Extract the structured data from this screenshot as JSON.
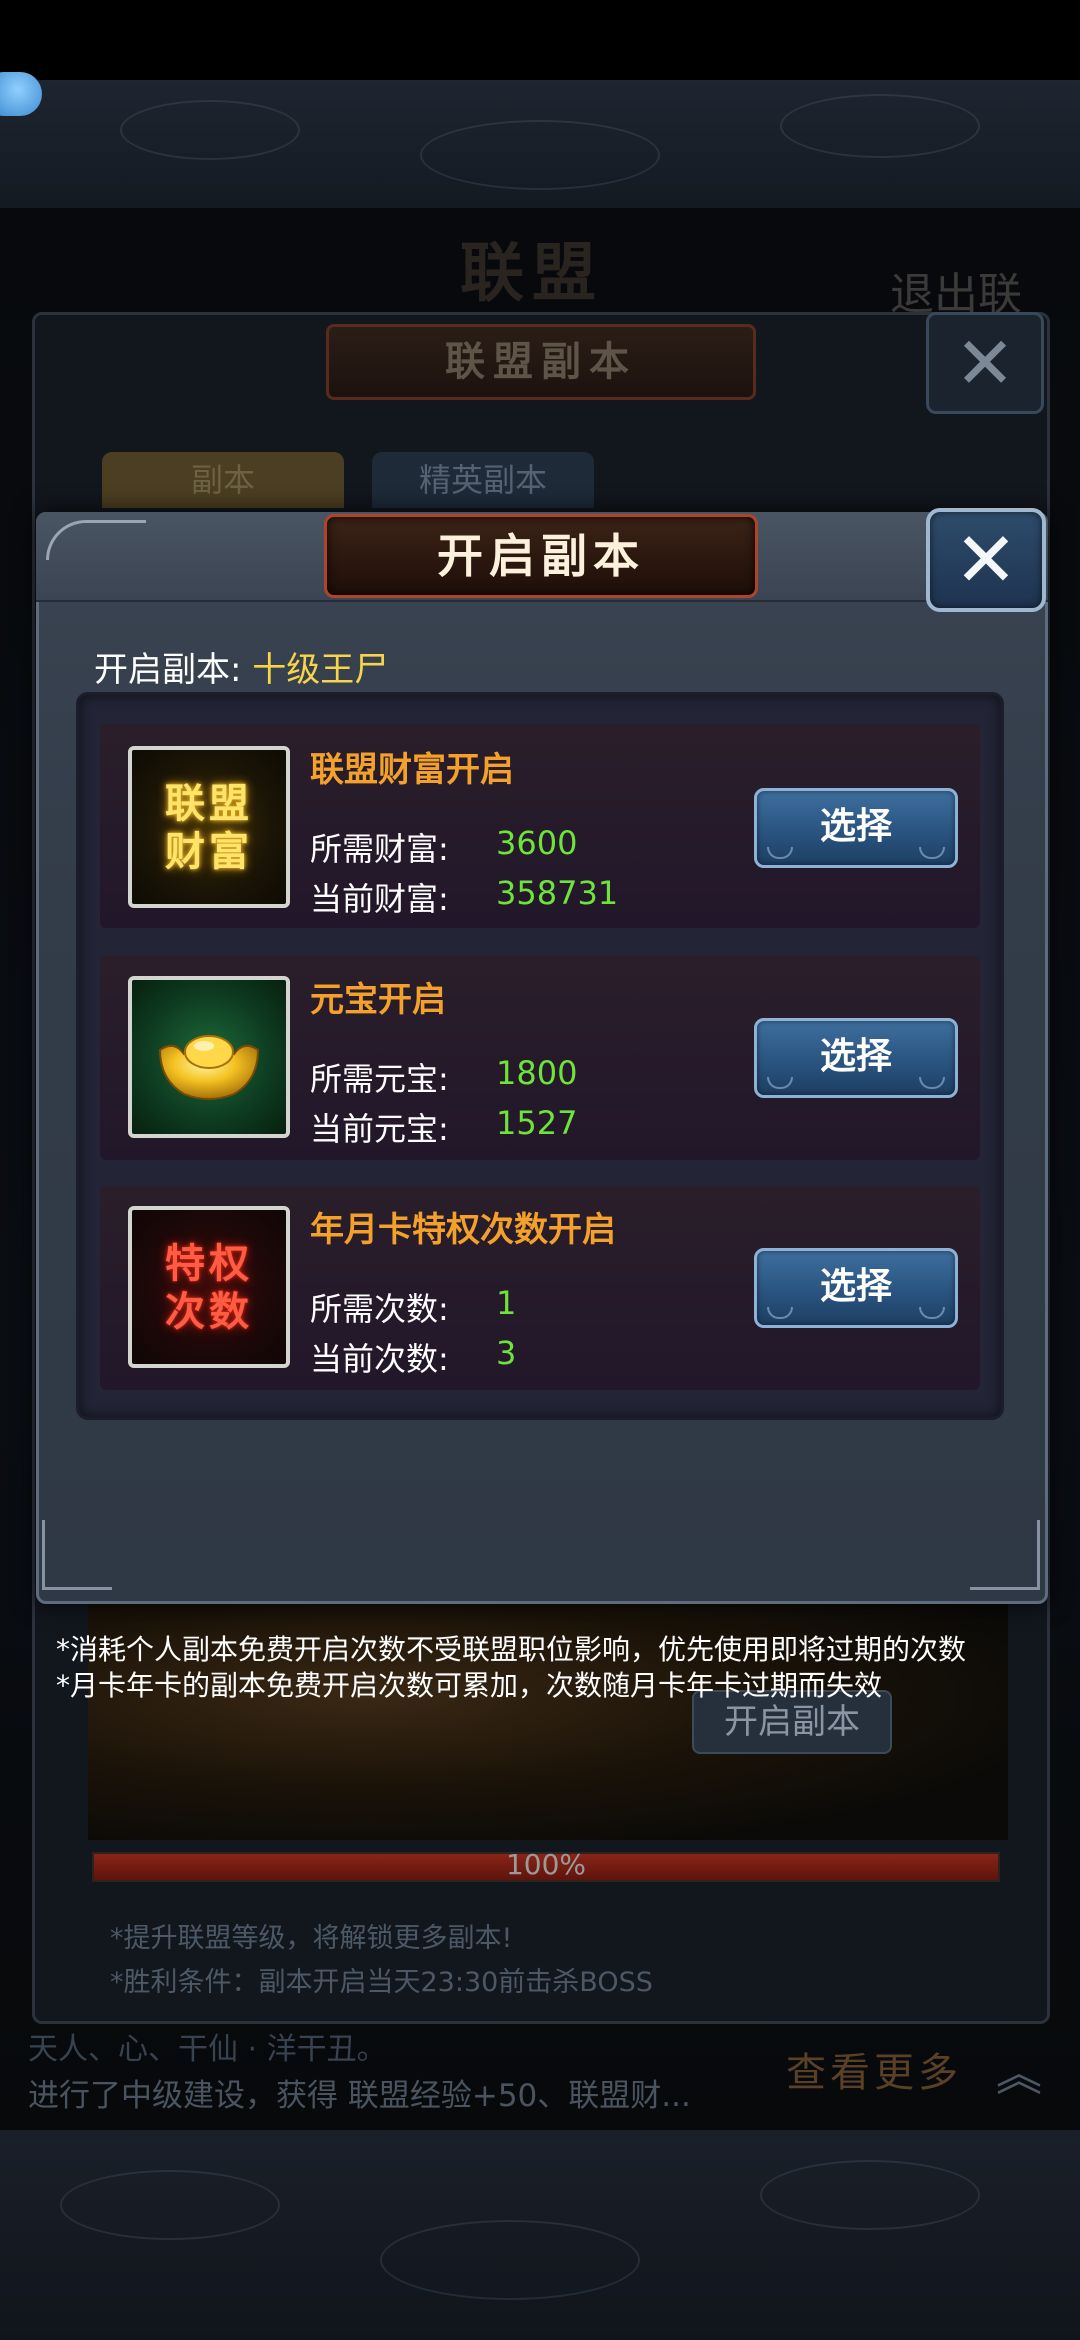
{
  "background_window": {
    "title": "联盟副本",
    "top_banner_title": "联盟",
    "top_right_text": "退出联",
    "tabs": [
      "副本",
      "精英副本"
    ],
    "open_button_label": "开启副本",
    "progress_percent": 100,
    "progress_label": "100%",
    "notes": [
      "*提升联盟等级，将解锁更多副本!",
      "*胜利条件：副本开启当天23:30前击杀BOSS"
    ],
    "chat_line_1": "天人、心、干仙  ·  洋干丑。",
    "chat_line_2": "进行了中级建设，获得 联盟经验+50、联盟财...",
    "view_more_label": "查看更多",
    "expand_icon": "double-chevron-up-icon"
  },
  "dialog": {
    "title": "开启副本",
    "close_icon": "close-x-icon",
    "subtitle_label": "开启副本:",
    "subtitle_value": "十级王尸",
    "options": [
      {
        "icon_text": "联盟财富",
        "icon_name": "alliance-wealth-icon",
        "title": "联盟财富开启",
        "required_label": "所需财富:",
        "required_value": "3600",
        "current_label": "当前财富:",
        "current_value": "358731",
        "button_label": "选择"
      },
      {
        "icon_text": "",
        "icon_name": "gold-ingot-icon",
        "title": "元宝开启",
        "required_label": "所需元宝:",
        "required_value": "1800",
        "current_label": "当前元宝:",
        "current_value": "1527",
        "button_label": "选择"
      },
      {
        "icon_text": "特权次数",
        "icon_name": "privilege-count-icon",
        "title": "年月卡特权次数开启",
        "required_label": "所需次数:",
        "required_value": "1",
        "current_label": "当前次数:",
        "current_value": "3",
        "button_label": "选择"
      }
    ],
    "footnotes": [
      "*消耗个人副本免费开启次数不受联盟职位影响，优先使用即将过期的次数",
      "*月卡年卡的副本免费开启次数可累加，次数随月卡年卡过期而失效"
    ]
  },
  "colors": {
    "option_title": "#f3a12a",
    "value_green": "#6ee43a",
    "subtitle_value": "#f7d44a",
    "button_blue": "#2a5480"
  }
}
